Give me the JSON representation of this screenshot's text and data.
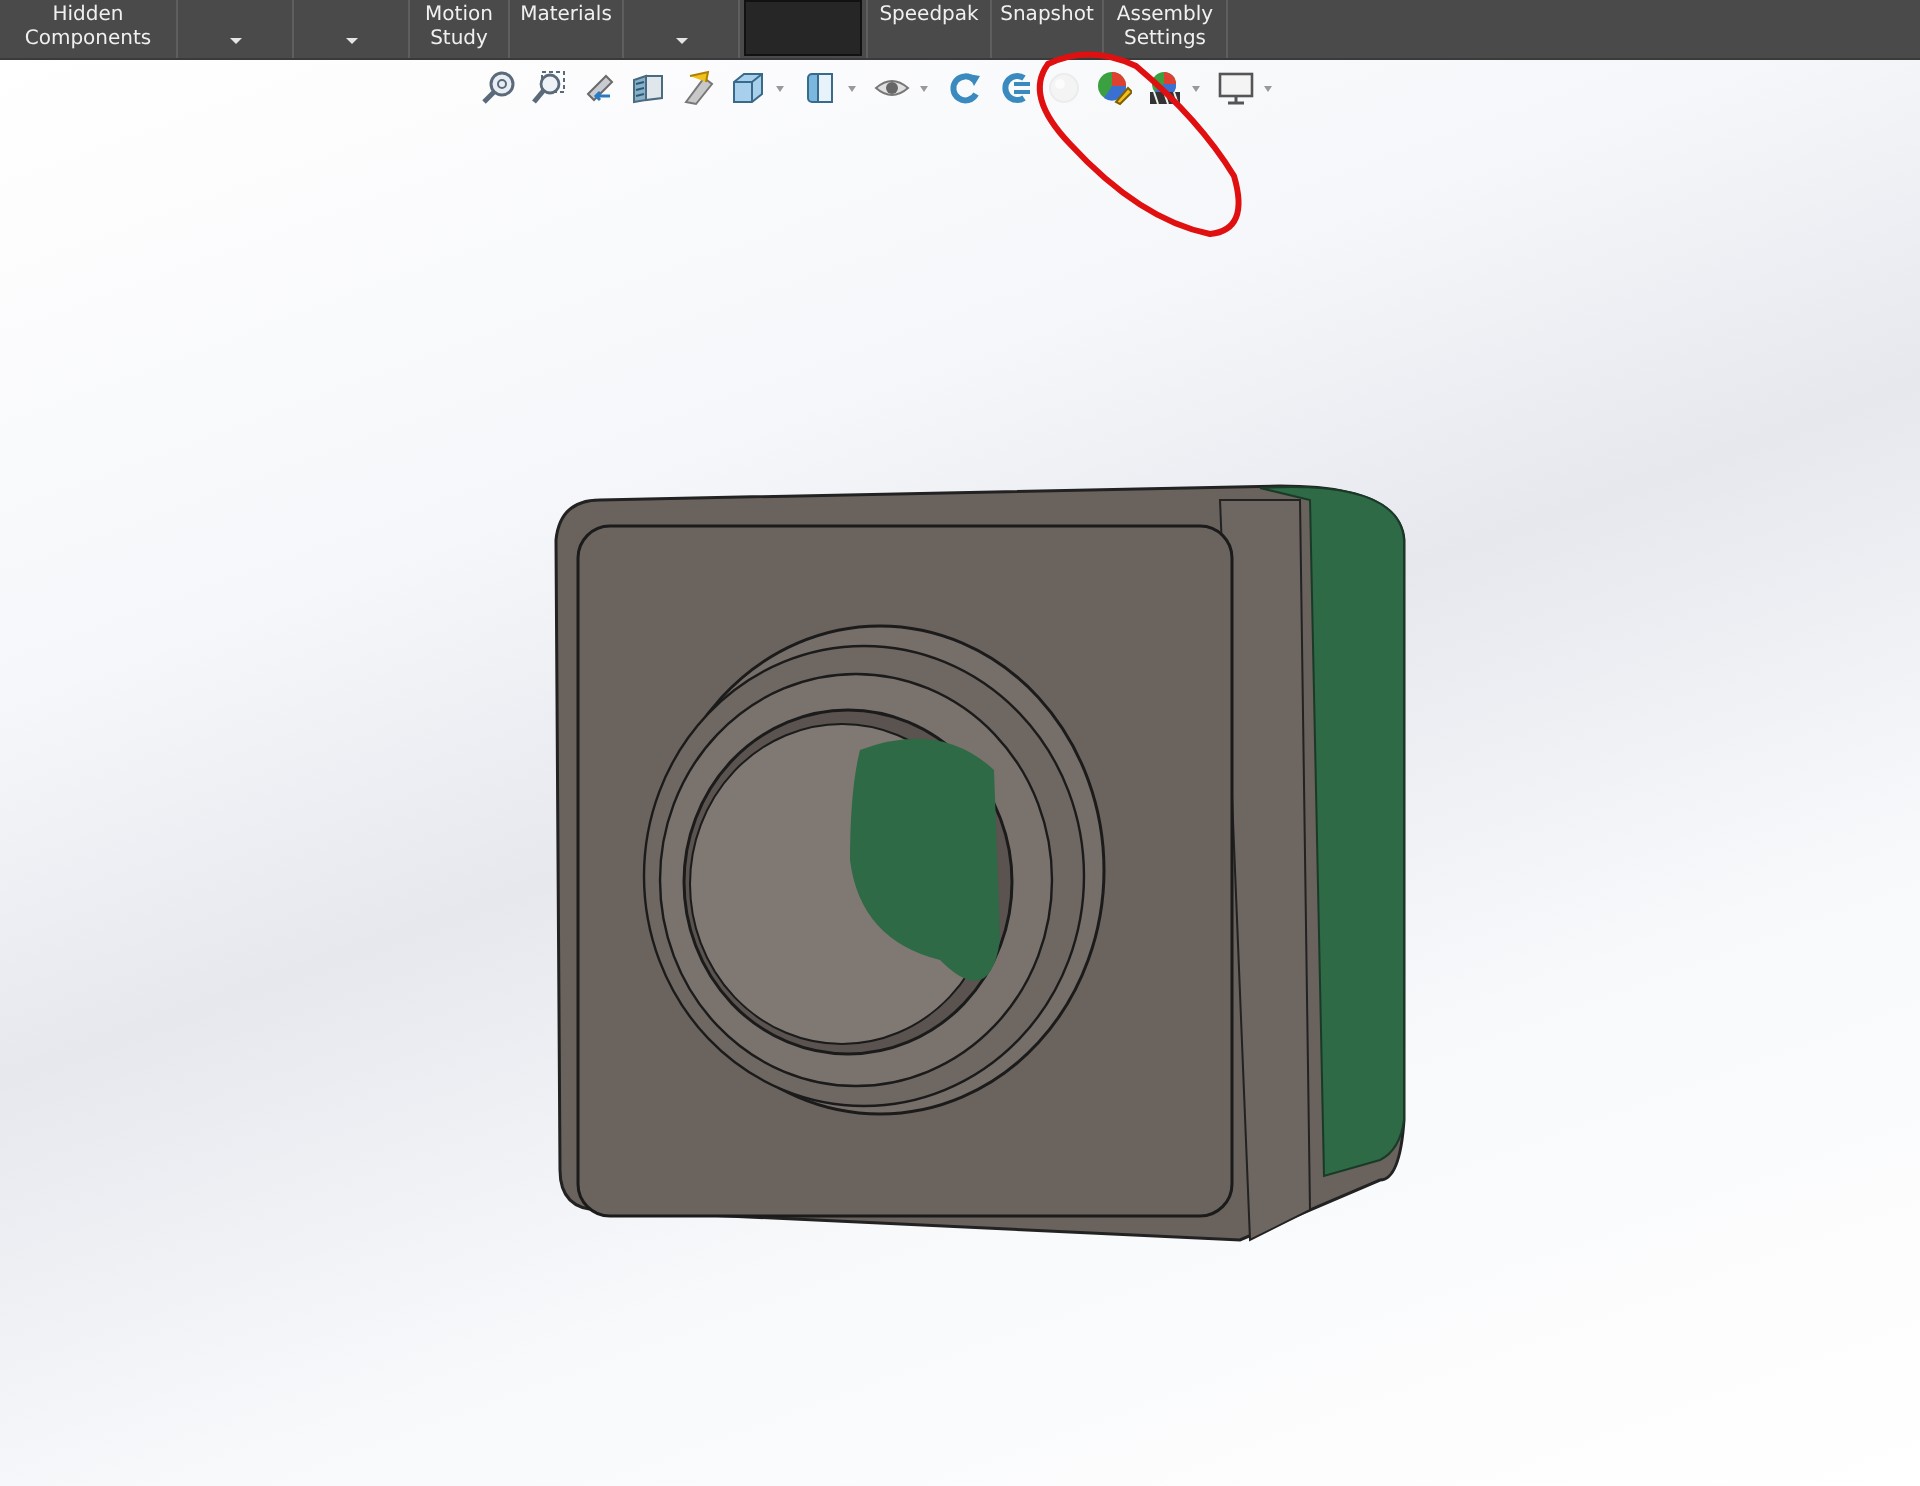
{
  "ribbon": {
    "items": [
      {
        "kind": "button",
        "lines": [
          "Hidden",
          "Components"
        ]
      },
      {
        "kind": "dropdown"
      },
      {
        "kind": "dropdown"
      },
      {
        "kind": "button",
        "lines": [
          "Motion",
          "Study"
        ]
      },
      {
        "kind": "button",
        "lines": [
          "Materials"
        ]
      },
      {
        "kind": "dropdown"
      },
      {
        "kind": "swatch",
        "color": "#262626"
      },
      {
        "kind": "button",
        "lines": [
          "Speedpak"
        ]
      },
      {
        "kind": "button",
        "lines": [
          "Snapshot"
        ]
      },
      {
        "kind": "button",
        "lines": [
          "Assembly",
          "Settings"
        ]
      }
    ]
  },
  "view_toolbar": {
    "items": [
      {
        "dropdown": false,
        "disabled": false
      },
      {
        "dropdown": false,
        "disabled": false
      },
      {
        "dropdown": false,
        "disabled": false
      },
      {
        "dropdown": false,
        "disabled": false
      },
      {
        "dropdown": false,
        "disabled": false
      },
      {
        "dropdown": true,
        "disabled": false
      },
      {
        "dropdown": true,
        "disabled": false
      },
      {
        "dropdown": true,
        "disabled": false
      },
      {
        "dropdown": false,
        "disabled": false
      },
      {
        "dropdown": false,
        "disabled": false
      },
      {
        "dropdown": false,
        "disabled": true
      },
      {
        "dropdown": false,
        "disabled": false
      },
      {
        "dropdown": true,
        "disabled": false
      },
      {
        "dropdown": true,
        "disabled": false
      }
    ]
  }
}
